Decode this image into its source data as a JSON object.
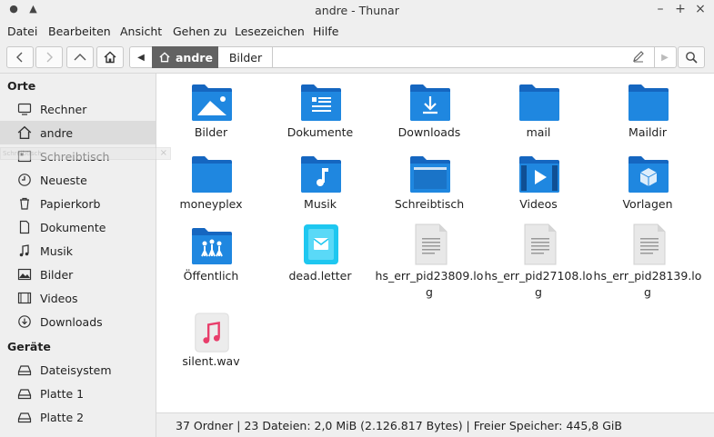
{
  "window": {
    "title": "andre - Thunar"
  },
  "menubar": {
    "items": [
      "Datei",
      "Bearbeiten",
      "Ansicht",
      "Gehen zu",
      "Lesezeichen",
      "Hilfe"
    ]
  },
  "pathbar": {
    "segments": [
      "andre",
      "Bilder"
    ]
  },
  "sidebar": {
    "section_places": "Orte",
    "section_devices": "Geräte",
    "places": [
      {
        "label": "Rechner",
        "icon": "computer-icon"
      },
      {
        "label": "andre",
        "icon": "home-icon",
        "selected": true
      },
      {
        "label": "Schreibtisch",
        "icon": "desktop-icon"
      },
      {
        "label": "Neueste",
        "icon": "clock-icon"
      },
      {
        "label": "Papierkorb",
        "icon": "trash-icon"
      },
      {
        "label": "Dokumente",
        "icon": "document-icon"
      },
      {
        "label": "Musik",
        "icon": "music-note-icon"
      },
      {
        "label": "Bilder",
        "icon": "image-icon"
      },
      {
        "label": "Videos",
        "icon": "video-icon"
      },
      {
        "label": "Downloads",
        "icon": "download-icon"
      }
    ],
    "devices": [
      {
        "label": "Dateisystem",
        "icon": "drive-icon"
      },
      {
        "label": "Platte 1",
        "icon": "drive-icon"
      },
      {
        "label": "Platte 2",
        "icon": "drive-icon"
      }
    ],
    "ghost_text": "Schreibtisch"
  },
  "files": [
    {
      "name": "Bilder",
      "icon": "folder-pictures-icon"
    },
    {
      "name": "Dokumente",
      "icon": "folder-documents-icon"
    },
    {
      "name": "Downloads",
      "icon": "folder-download-icon"
    },
    {
      "name": "mail",
      "icon": "folder-icon"
    },
    {
      "name": "Maildir",
      "icon": "folder-icon"
    },
    {
      "name": "moneyplex",
      "icon": "folder-icon"
    },
    {
      "name": "Musik",
      "icon": "folder-music-icon"
    },
    {
      "name": "Schreibtisch",
      "icon": "folder-desktop-icon"
    },
    {
      "name": "Videos",
      "icon": "folder-videos-icon"
    },
    {
      "name": "Vorlagen",
      "icon": "folder-templates-icon"
    },
    {
      "name": "Öffentlich",
      "icon": "folder-public-icon"
    },
    {
      "name": "dead.letter",
      "icon": "mail-file-icon"
    },
    {
      "name": "hs_err_pid23809.log",
      "icon": "text-file-icon"
    },
    {
      "name": "hs_err_pid27108.log",
      "icon": "text-file-icon"
    },
    {
      "name": "hs_err_pid28139.log",
      "icon": "text-file-icon"
    },
    {
      "name": "silent.wav",
      "icon": "audio-file-icon"
    }
  ],
  "statusbar": {
    "text": "37 Ordner  |  23 Dateien: 2,0 MiB (2.126.817 Bytes)  |  Freier Speicher: 445,8 GiB"
  },
  "colors": {
    "folder": "#1f87e0",
    "folder_dark": "#1566c0",
    "accent": "#626262"
  }
}
